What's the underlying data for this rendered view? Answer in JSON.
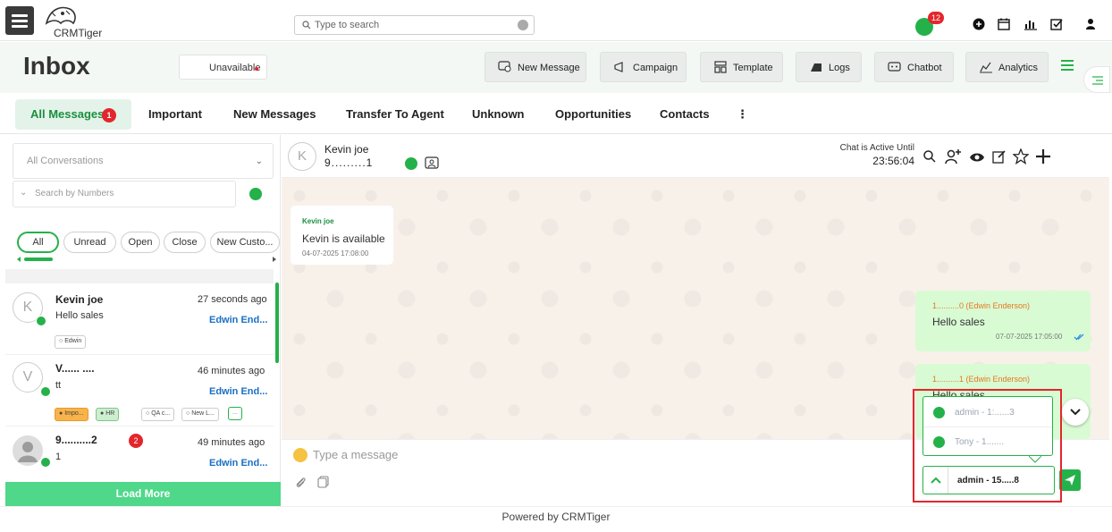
{
  "header": {
    "brand": "CRMTiger",
    "search_placeholder": "Type to search",
    "whatsapp_count": "12"
  },
  "inbox": {
    "title": "Inbox",
    "status": "Unavailable",
    "buttons": {
      "new_message": "New Message",
      "campaign": "Campaign",
      "template": "Template",
      "logs": "Logs",
      "chatbot": "Chatbot",
      "analytics": "Analytics"
    }
  },
  "tabs": [
    {
      "label": "All Messages",
      "badge": "1"
    },
    {
      "label": "Important"
    },
    {
      "label": "New Messages"
    },
    {
      "label": "Transfer To Agent"
    },
    {
      "label": "Unknown"
    },
    {
      "label": "Opportunities"
    },
    {
      "label": "Contacts"
    },
    {
      "label": "⋮"
    }
  ],
  "sidebar": {
    "conversation_filter": "All Conversations",
    "number_search_placeholder": "Search by Numbers",
    "chips": [
      "All",
      "Unread",
      "Open",
      "Close",
      "New Custo..."
    ],
    "conversations": [
      {
        "avatar": "K",
        "name": "Kevin joe",
        "time": "27 seconds ago",
        "message": "Hello sales",
        "agent": "Edwin End...",
        "tags": [
          "Edwin"
        ]
      },
      {
        "avatar": "V",
        "name": "V...... ....",
        "time": "46 minutes ago",
        "message": "tt",
        "agent": "Edwin End...",
        "tags": [
          "Impo...",
          "HR",
          "QA c...",
          "New L...",
          "..."
        ]
      },
      {
        "avatar": "",
        "name": "9..........2",
        "badge": "2",
        "time": "49 minutes ago",
        "message": "1",
        "agent": "Edwin End...",
        "tags": []
      }
    ],
    "load_more": "Load More"
  },
  "chat": {
    "avatar": "K",
    "name": "Kevin joe",
    "phone": "9.........1",
    "active_label": "Chat is Active Until",
    "active_time": "23:56:04",
    "messages": [
      {
        "sender": "Kevin joe",
        "text": "Kevin is available",
        "time": "04-07-2025 17:08:00"
      },
      {
        "sender": "1..........0 (Edwin Enderson)",
        "text": "Hello sales",
        "time": "07-07-2025 17:05:00"
      },
      {
        "sender": "1..........1 (Edwin Enderson)",
        "text": "Hello sales",
        "time": ""
      }
    ],
    "composer_placeholder": "Type a message"
  },
  "agent_selector": {
    "options": [
      "admin - 1:......3",
      "Tony - 1......."
    ],
    "selected": "admin - 15.....8"
  },
  "footer": "Powered by CRMTiger",
  "colors": {
    "accent": "#25b14a",
    "badge": "#e3262c",
    "agent_link": "#1a6fc2",
    "outgoing_bubble": "#d8fbd3",
    "load_more": "#4fd88a"
  }
}
